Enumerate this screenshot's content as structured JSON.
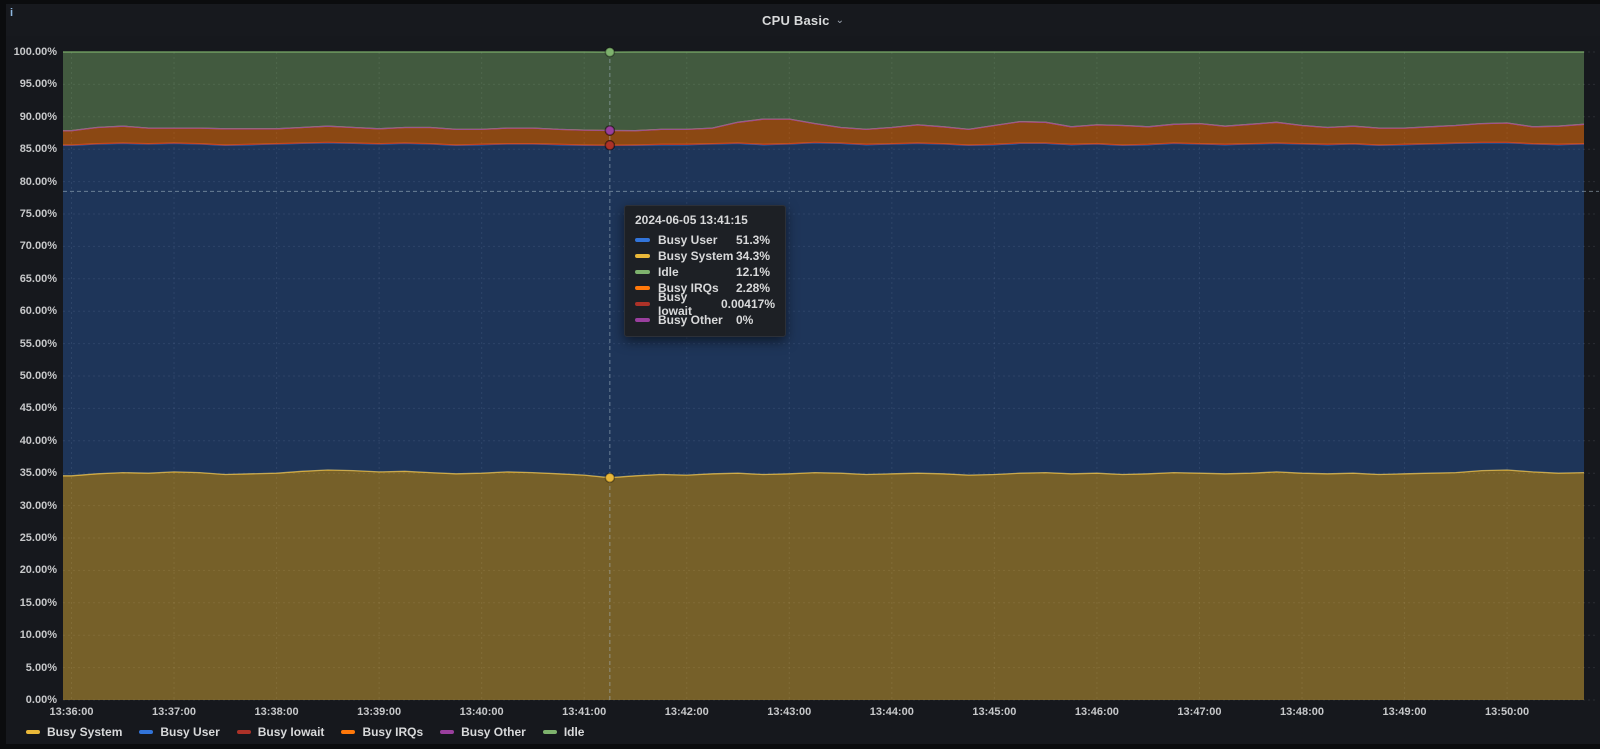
{
  "panel": {
    "title": "CPU Basic",
    "chevron": "⌄",
    "info_icon": "i"
  },
  "colors": {
    "page_bg": "#0b0c0e",
    "panel_bg": "#16181d",
    "header_bg": "#17191e",
    "grid": "#c7d0d9",
    "axis_text": "#c7c8ca",
    "title_text": "#d8d9da",
    "tooltip_bg": "#1d2025",
    "crosshair": "#a9bcc9"
  },
  "y_axis": {
    "ticks": [
      "100.00%",
      "95.00%",
      "90.00%",
      "85.00%",
      "80.00%",
      "75.00%",
      "70.00%",
      "65.00%",
      "60.00%",
      "55.00%",
      "50.00%",
      "45.00%",
      "40.00%",
      "35.00%",
      "30.00%",
      "25.00%",
      "20.00%",
      "15.00%",
      "10.00%",
      "5.00%",
      "0.00%"
    ]
  },
  "x_axis": {
    "ticks": [
      "13:36:00",
      "13:37:00",
      "13:38:00",
      "13:39:00",
      "13:40:00",
      "13:41:00",
      "13:42:00",
      "13:43:00",
      "13:44:00",
      "13:45:00",
      "13:46:00",
      "13:47:00",
      "13:48:00",
      "13:49:00",
      "13:50:00"
    ]
  },
  "legend": {
    "items": [
      {
        "label": "Busy System",
        "color": "#EAB839"
      },
      {
        "label": "Busy User",
        "color": "#3274D9"
      },
      {
        "label": "Busy Iowait",
        "color": "#AD3228"
      },
      {
        "label": "Busy IRQs",
        "color": "#FF780A"
      },
      {
        "label": "Busy Other",
        "color": "#9A3F9E"
      },
      {
        "label": "Idle",
        "color": "#7EB26D"
      }
    ]
  },
  "tooltip": {
    "timestamp": "2024-06-05 13:41:15",
    "rows": [
      {
        "label": "Busy User",
        "value": "51.3%",
        "color": "#3274D9"
      },
      {
        "label": "Busy System",
        "value": "34.3%",
        "color": "#EAB839"
      },
      {
        "label": "Idle",
        "value": "12.1%",
        "color": "#7EB26D"
      },
      {
        "label": "Busy IRQs",
        "value": "2.28%",
        "color": "#FF780A"
      },
      {
        "label": "Busy Iowait",
        "value": "0.00417%",
        "color": "#AD3228"
      },
      {
        "label": "Busy Other",
        "value": "0%",
        "color": "#9A3F9E"
      }
    ]
  },
  "chart_data": {
    "type": "area",
    "stacked": true,
    "unit": "%",
    "ylim": [
      0,
      100
    ],
    "y_tick_step": 5,
    "x_start": "13:36:00",
    "x_end": "13:50:45",
    "x_step_seconds": 15,
    "grid": true,
    "legend_position": "bottom",
    "crosshair": {
      "timestamp": "2024-06-05 13:41:15",
      "index": 21,
      "h_line_percent": 78.5
    },
    "series": [
      {
        "name": "Busy System",
        "color": "#EAB839",
        "fill_opacity": 0.45,
        "values": [
          34.6,
          34.9,
          35.1,
          35.0,
          35.2,
          35.1,
          34.8,
          34.9,
          35.0,
          35.3,
          35.5,
          35.4,
          35.2,
          35.3,
          35.1,
          34.9,
          35.0,
          35.2,
          35.1,
          34.9,
          34.7,
          34.3,
          34.6,
          34.8,
          34.7,
          34.9,
          35.0,
          34.8,
          34.9,
          35.1,
          35.0,
          34.8,
          34.9,
          35.0,
          34.9,
          34.7,
          34.8,
          35.0,
          35.1,
          34.9,
          35.0,
          34.8,
          34.9,
          35.1,
          35.0,
          34.9,
          35.0,
          35.2,
          35.0,
          34.9,
          35.0,
          34.8,
          34.9,
          35.0,
          35.1,
          35.4,
          35.5,
          35.2,
          35.0,
          35.1
        ]
      },
      {
        "name": "Busy User",
        "color": "#3274D9",
        "fill_opacity": 0.32,
        "values": [
          51.0,
          50.9,
          50.8,
          50.8,
          50.7,
          50.7,
          50.8,
          50.8,
          50.8,
          50.6,
          50.5,
          50.5,
          50.6,
          50.6,
          50.7,
          50.7,
          50.7,
          50.6,
          50.7,
          50.8,
          50.9,
          51.3,
          51.0,
          50.9,
          51.0,
          50.9,
          50.9,
          50.9,
          50.9,
          50.9,
          50.9,
          50.9,
          50.9,
          50.9,
          50.9,
          50.9,
          50.9,
          50.9,
          50.8,
          50.8,
          50.8,
          50.8,
          50.8,
          50.8,
          50.8,
          50.8,
          50.8,
          50.7,
          50.8,
          50.8,
          50.8,
          50.8,
          50.8,
          50.8,
          50.8,
          50.6,
          50.5,
          50.6,
          50.7,
          50.7
        ]
      },
      {
        "name": "Busy Iowait",
        "color": "#AD3228",
        "fill_opacity": 0.5,
        "values": [
          0.05,
          0.05,
          0.05,
          0.05,
          0.05,
          0.05,
          0.05,
          0.05,
          0.05,
          0.05,
          0.05,
          0.05,
          0.05,
          0.05,
          0.05,
          0.05,
          0.05,
          0.05,
          0.05,
          0.05,
          0.05,
          0.004,
          0.05,
          0.05,
          0.05,
          0.05,
          0.05,
          0.05,
          0.05,
          0.05,
          0.05,
          0.05,
          0.05,
          0.05,
          0.05,
          0.05,
          0.05,
          0.05,
          0.05,
          0.05,
          0.05,
          0.05,
          0.05,
          0.05,
          0.05,
          0.05,
          0.05,
          0.05,
          0.05,
          0.05,
          0.05,
          0.05,
          0.05,
          0.05,
          0.05,
          0.05,
          0.05,
          0.05,
          0.05,
          0.05
        ]
      },
      {
        "name": "Busy IRQs",
        "color": "#FF780A",
        "fill_opacity": 0.5,
        "values": [
          2.2,
          2.5,
          2.6,
          2.4,
          2.3,
          2.4,
          2.5,
          2.4,
          2.3,
          2.4,
          2.5,
          2.4,
          2.3,
          2.4,
          2.5,
          2.4,
          2.3,
          2.4,
          2.4,
          2.3,
          2.3,
          2.28,
          2.2,
          2.3,
          2.3,
          2.4,
          3.2,
          3.9,
          3.8,
          2.9,
          2.4,
          2.3,
          2.5,
          2.8,
          2.6,
          2.4,
          2.9,
          3.3,
          3.2,
          2.7,
          2.9,
          3.0,
          2.7,
          2.9,
          3.1,
          2.8,
          3.0,
          3.2,
          2.8,
          2.6,
          2.7,
          2.6,
          2.5,
          2.6,
          2.7,
          2.9,
          3.0,
          2.6,
          2.8,
          3.0
        ]
      },
      {
        "name": "Busy Other",
        "color": "#9A3F9E",
        "fill_opacity": 0.5,
        "values": [
          0,
          0,
          0,
          0,
          0,
          0,
          0,
          0,
          0,
          0,
          0,
          0,
          0,
          0,
          0,
          0,
          0,
          0,
          0,
          0,
          0,
          0,
          0,
          0,
          0,
          0,
          0,
          0,
          0,
          0,
          0,
          0,
          0,
          0,
          0,
          0,
          0,
          0,
          0,
          0,
          0,
          0,
          0,
          0,
          0,
          0,
          0,
          0,
          0,
          0,
          0,
          0,
          0,
          0,
          0,
          0,
          0,
          0,
          0,
          0
        ]
      },
      {
        "name": "Idle",
        "color": "#7EB26D",
        "fill_opacity": 0.43,
        "values": [
          12.15,
          11.65,
          11.45,
          11.75,
          11.75,
          11.75,
          11.85,
          11.85,
          11.85,
          11.65,
          11.45,
          11.65,
          11.85,
          11.65,
          11.65,
          11.95,
          11.95,
          11.75,
          11.75,
          11.95,
          12.05,
          12.1,
          12.15,
          11.95,
          11.95,
          11.75,
          10.85,
          10.35,
          10.35,
          11.05,
          11.65,
          11.95,
          11.65,
          11.25,
          11.55,
          11.95,
          11.35,
          10.75,
          10.85,
          11.55,
          11.25,
          11.35,
          11.55,
          11.15,
          11.05,
          11.45,
          11.15,
          10.85,
          11.35,
          11.65,
          11.45,
          11.75,
          11.75,
          11.55,
          11.35,
          11.05,
          10.95,
          11.55,
          11.45,
          11.15
        ]
      }
    ]
  }
}
